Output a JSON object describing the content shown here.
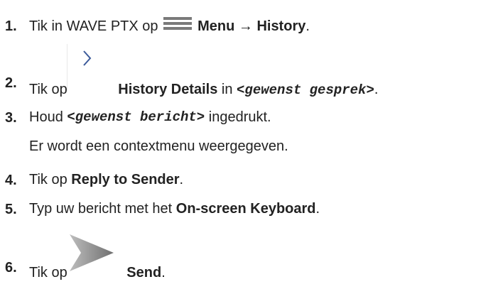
{
  "steps": [
    {
      "number": "1.",
      "parts": {
        "a": "Tik in WAVE PTX op ",
        "icon": "hamburger-menu-icon",
        "b": "Menu",
        "c": " → ",
        "d": "History",
        "e": "."
      }
    },
    {
      "number": "2.",
      "parts": {
        "a": "Tik op ",
        "icon": "chevron-right-icon",
        "b": "History Details",
        "c": " in ",
        "d": "<gewenst gesprek>",
        "e": "."
      }
    },
    {
      "number": "3.",
      "parts": {
        "a": "Houd ",
        "b": "<gewenst bericht>",
        "c": " ingedrukt."
      },
      "note": "Er wordt een contextmenu weergegeven."
    },
    {
      "number": "4.",
      "parts": {
        "a": "Tik op ",
        "b": "Reply to Sender",
        "c": "."
      }
    },
    {
      "number": "5.",
      "parts": {
        "a": "Typ uw bericht met het ",
        "b": "On-screen Keyboard",
        "c": "."
      }
    },
    {
      "number": "6.",
      "parts": {
        "a": "Tik op ",
        "icon": "send-arrow-icon",
        "b": "Send",
        "c": "."
      }
    }
  ],
  "colors": {
    "text": "#222222",
    "menu_icon": "#7a7a7a",
    "chevron_icon": "#3b5a9a",
    "send_icon": "#8a8a8a"
  }
}
